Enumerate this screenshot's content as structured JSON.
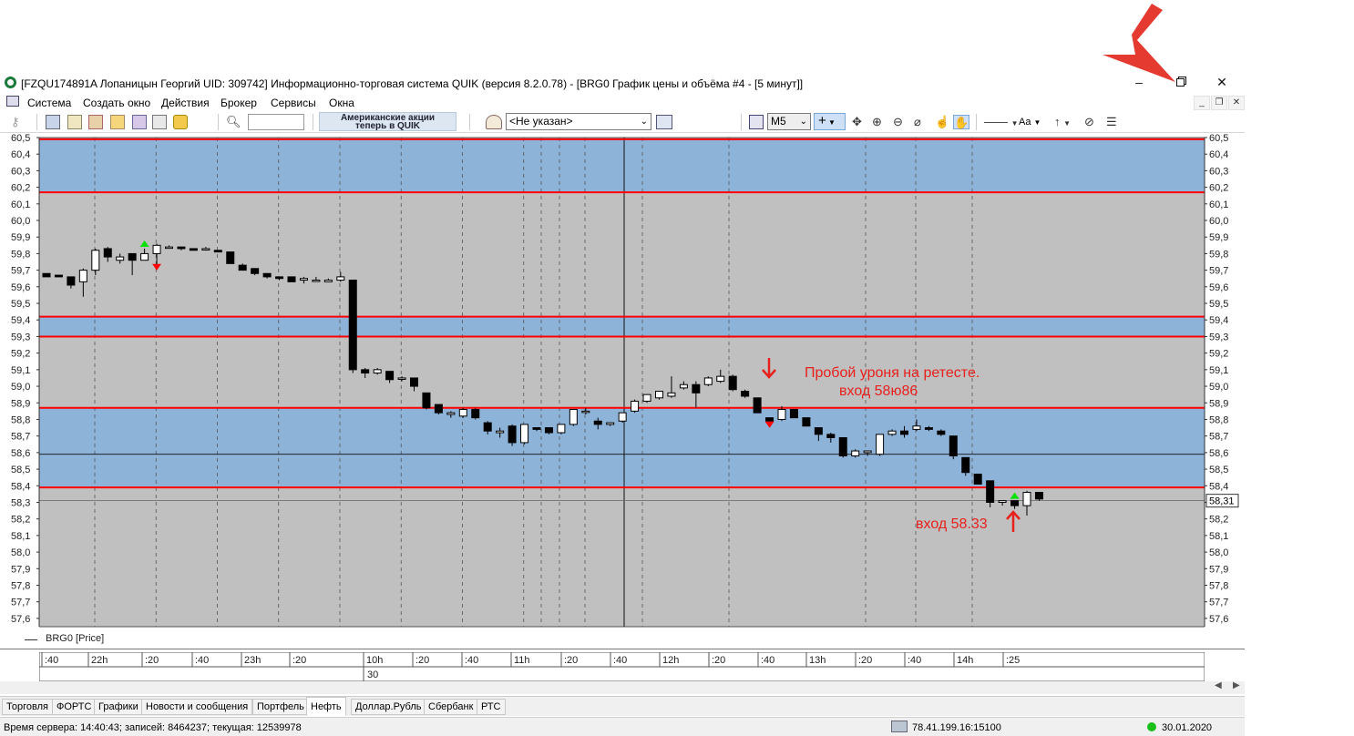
{
  "window": {
    "title": "[FZQU174891A Лопаницын Георгий UID: 309742] Информационно-торговая система QUIK (версия 8.2.0.78) - [BRG0 График цены и объёма #4 - [5 минут]]"
  },
  "menu": [
    "Система",
    "Создать окно",
    "Действия",
    "Брокер",
    "Сервисы",
    "Окна"
  ],
  "toolbar": {
    "banner_line1": "Американские акции",
    "banner_line2": "теперь в QUIK",
    "account_select": "<Не указан>",
    "interval_select": "M5",
    "font_label": "Aa"
  },
  "chart": {
    "legend_label": "BRG0 [Price]",
    "current_price_label": "58,31",
    "annotation_1_line1": "Пробой уроня на ретесте.",
    "annotation_1_line2": "вход  58ю86",
    "annotation_2": "вход  58.33",
    "y_labels": [
      "60,5",
      "60,4",
      "60,3",
      "60,2",
      "60,1",
      "60,0",
      "59,9",
      "59,8",
      "59,7",
      "59,6",
      "59,5",
      "59,4",
      "59,3",
      "59,2",
      "59,1",
      "59,0",
      "58,9",
      "58,8",
      "58,7",
      "58,6",
      "58,5",
      "58,4",
      "58,3",
      "58,2",
      "58,1",
      "58,0",
      "57,9",
      "57,8",
      "57,7",
      "57,6"
    ],
    "x_labels": [
      ":40",
      "22h",
      ":20",
      ":40",
      "23h",
      ":20",
      "10h",
      ":20",
      ":40",
      "11h",
      ":20",
      ":40",
      "12h",
      ":20",
      ":40",
      "13h",
      ":20",
      ":40",
      "14h",
      ":25"
    ],
    "date_label": "30",
    "colors": {
      "plot_bg": "#c0c0c0",
      "zone_fill": "#8eb3d9",
      "level_line": "#ff0000",
      "annotation": "#e8201c"
    }
  },
  "chart_data": {
    "type": "candlestick",
    "symbol": "BRG0",
    "interval": "5 минут",
    "ylim": [
      57.55,
      60.5
    ],
    "horizontal_levels": [
      60.49,
      60.17,
      59.42,
      59.3,
      58.87,
      58.39
    ],
    "zones": [
      [
        60.17,
        60.49
      ],
      [
        58.39,
        58.87
      ],
      [
        59.3,
        59.42
      ]
    ],
    "current_price": 58.31,
    "candles": [
      [
        59.68,
        59.68,
        59.66,
        59.66
      ],
      [
        59.67,
        59.67,
        59.66,
        59.66
      ],
      [
        59.66,
        59.66,
        59.59,
        59.61
      ],
      [
        59.63,
        59.71,
        59.54,
        59.7
      ],
      [
        59.7,
        59.83,
        59.67,
        59.82
      ],
      [
        59.83,
        59.84,
        59.75,
        59.78
      ],
      [
        59.76,
        59.8,
        59.74,
        59.78
      ],
      [
        59.8,
        59.8,
        59.67,
        59.76
      ],
      [
        59.76,
        59.83,
        59.76,
        59.8
      ],
      [
        59.8,
        59.86,
        59.71,
        59.85
      ],
      [
        59.84,
        59.85,
        59.83,
        59.84
      ],
      [
        59.84,
        59.84,
        59.82,
        59.83
      ],
      [
        59.83,
        59.83,
        59.82,
        59.82
      ],
      [
        59.83,
        59.84,
        59.82,
        59.83
      ],
      [
        59.82,
        59.82,
        59.81,
        59.81
      ],
      [
        59.81,
        59.81,
        59.74,
        59.74
      ],
      [
        59.73,
        59.74,
        59.7,
        59.7
      ],
      [
        59.71,
        59.71,
        59.67,
        59.68
      ],
      [
        59.68,
        59.68,
        59.65,
        59.66
      ],
      [
        59.66,
        59.66,
        59.64,
        59.65
      ],
      [
        59.66,
        59.66,
        59.63,
        59.63
      ],
      [
        59.64,
        59.66,
        59.62,
        59.65
      ],
      [
        59.64,
        59.66,
        59.63,
        59.64
      ],
      [
        59.63,
        59.65,
        59.63,
        59.64
      ],
      [
        59.64,
        59.69,
        59.63,
        59.66
      ],
      [
        59.64,
        59.64,
        59.08,
        59.1
      ],
      [
        59.1,
        59.11,
        59.05,
        59.08
      ],
      [
        59.08,
        59.11,
        59.07,
        59.1
      ],
      [
        59.09,
        59.09,
        59.02,
        59.04
      ],
      [
        59.05,
        59.06,
        59.03,
        59.05
      ],
      [
        59.05,
        59.05,
        58.97,
        59.0
      ],
      [
        58.96,
        58.96,
        58.86,
        58.87
      ],
      [
        58.89,
        58.89,
        58.83,
        58.84
      ],
      [
        58.83,
        58.85,
        58.81,
        58.84
      ],
      [
        58.82,
        58.87,
        58.81,
        58.86
      ],
      [
        58.86,
        58.87,
        58.8,
        58.81
      ],
      [
        58.78,
        58.79,
        58.71,
        58.73
      ],
      [
        58.72,
        58.75,
        58.69,
        58.73
      ],
      [
        58.76,
        58.77,
        58.64,
        58.66
      ],
      [
        58.66,
        58.77,
        58.65,
        58.77
      ],
      [
        58.75,
        58.75,
        58.73,
        58.74
      ],
      [
        58.75,
        58.75,
        58.71,
        58.72
      ],
      [
        58.72,
        58.77,
        58.71,
        58.77
      ],
      [
        58.77,
        58.86,
        58.76,
        58.86
      ],
      [
        58.85,
        58.87,
        58.83,
        58.85
      ],
      [
        58.79,
        58.81,
        58.74,
        58.77
      ],
      [
        58.77,
        58.78,
        58.76,
        58.78
      ],
      [
        58.79,
        58.84,
        58.78,
        58.84
      ],
      [
        58.85,
        58.92,
        58.84,
        58.91
      ],
      [
        58.91,
        58.95,
        58.9,
        58.95
      ],
      [
        58.93,
        58.97,
        58.92,
        58.97
      ],
      [
        58.94,
        59.06,
        58.93,
        58.96
      ],
      [
        58.99,
        59.03,
        58.98,
        59.01
      ],
      [
        59.01,
        59.03,
        58.87,
        58.96
      ],
      [
        59.01,
        59.06,
        59.0,
        59.05
      ],
      [
        59.03,
        59.1,
        59.02,
        59.06
      ],
      [
        59.06,
        59.07,
        58.97,
        58.98
      ],
      [
        58.97,
        58.98,
        58.93,
        58.94
      ],
      [
        58.93,
        58.93,
        58.84,
        58.84
      ],
      [
        58.81,
        58.81,
        58.76,
        58.79
      ],
      [
        58.8,
        58.88,
        58.79,
        58.86
      ],
      [
        58.86,
        58.86,
        58.81,
        58.81
      ],
      [
        58.81,
        58.81,
        58.77,
        58.76
      ],
      [
        58.75,
        58.75,
        58.67,
        58.71
      ],
      [
        58.71,
        58.72,
        58.66,
        58.69
      ],
      [
        58.69,
        58.69,
        58.57,
        58.58
      ],
      [
        58.58,
        58.62,
        58.57,
        58.61
      ],
      [
        58.6,
        58.61,
        58.58,
        58.61
      ],
      [
        58.59,
        58.71,
        58.58,
        58.71
      ],
      [
        58.71,
        58.74,
        58.7,
        58.73
      ],
      [
        58.73,
        58.76,
        58.69,
        58.71
      ],
      [
        58.74,
        58.8,
        58.73,
        58.76
      ],
      [
        58.75,
        58.76,
        58.73,
        58.74
      ],
      [
        58.73,
        58.74,
        58.7,
        58.71
      ],
      [
        58.7,
        58.7,
        58.56,
        58.58
      ],
      [
        58.57,
        58.57,
        58.46,
        58.48
      ],
      [
        58.47,
        58.47,
        58.41,
        58.41
      ],
      [
        58.43,
        58.43,
        58.27,
        58.3
      ],
      [
        58.3,
        58.31,
        58.28,
        58.31
      ],
      [
        58.31,
        58.31,
        58.26,
        58.28
      ],
      [
        58.28,
        58.37,
        58.22,
        58.36
      ],
      [
        58.36,
        58.36,
        58.31,
        58.32
      ]
    ],
    "signals": [
      {
        "bar": 8,
        "type": "buy"
      },
      {
        "bar": 9,
        "type": "sell"
      },
      {
        "bar": 59,
        "type": "sell"
      },
      {
        "bar": 79,
        "type": "buy"
      }
    ]
  },
  "tabs": [
    "Торговля",
    "ФОРТС",
    "Графики",
    "Новости и сообщения",
    "Портфель",
    "Нефть",
    "Доллар.Рубль",
    "Сбербанк",
    "РТС"
  ],
  "active_tab": "Нефть",
  "status": {
    "server": "Время сервера: 14:40:43; записей: 8464237; текущая: 12539978",
    "connection": "78.41.199.16:15100",
    "date": "30.01.2020"
  }
}
